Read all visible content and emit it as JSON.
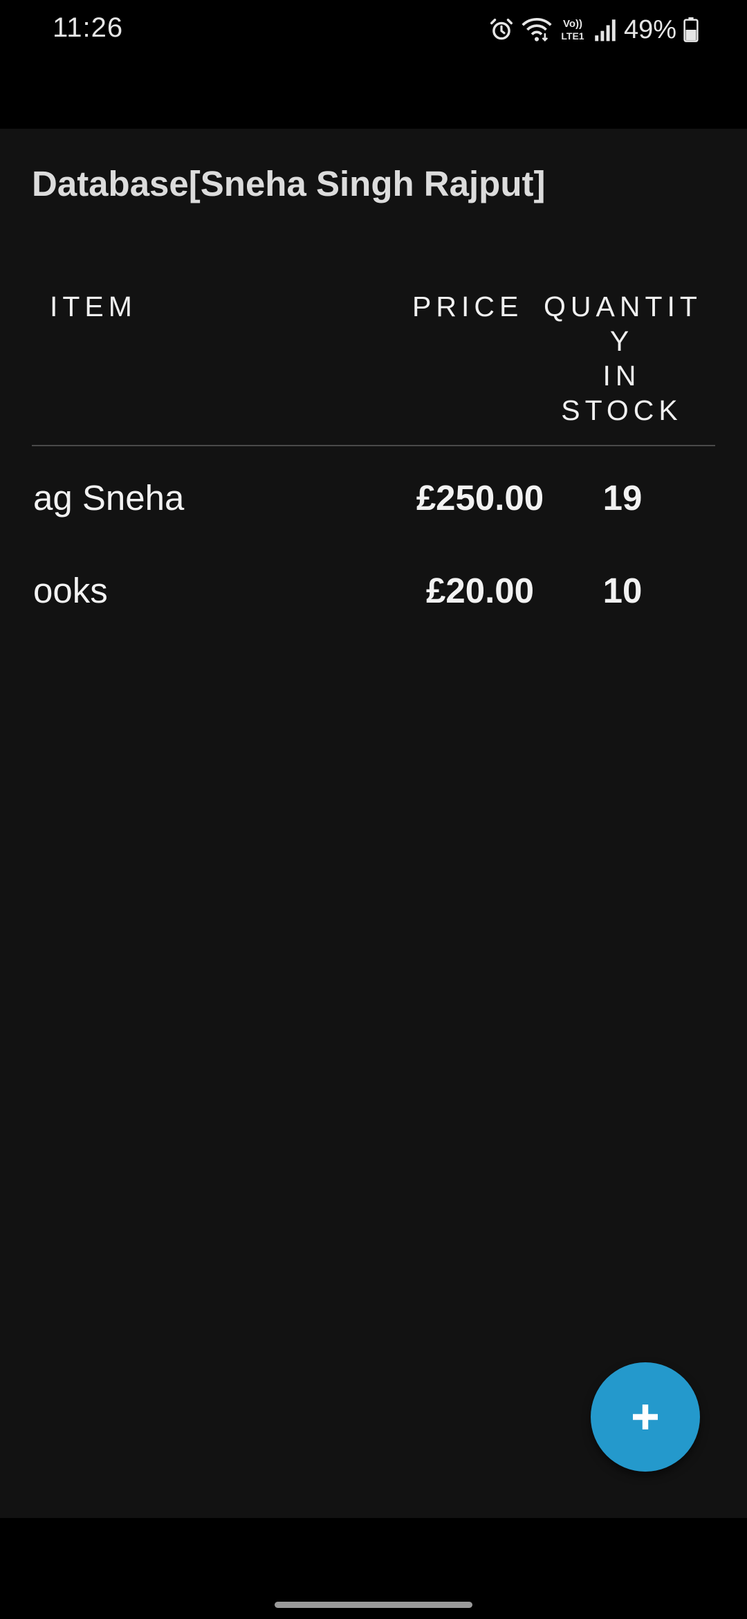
{
  "status_bar": {
    "time": "11:26",
    "battery_percent": "49%",
    "icons": [
      "alarm-icon",
      "wifi-icon",
      "volte-icon",
      "signal-icon",
      "battery-icon"
    ],
    "volte_line1": "Vo))",
    "volte_line2": "LTE1"
  },
  "app": {
    "title": "Database[Sneha Singh Rajput]",
    "columns": {
      "item": "ITEM",
      "price": "PRICE",
      "quantity": "QUANTIT\nY\nIN\nSTOCK"
    },
    "rows": [
      {
        "item": "Bag Sneha",
        "price": "£250.00",
        "quantity": "19"
      },
      {
        "item": "Books",
        "price": "£20.00",
        "quantity": "10"
      }
    ],
    "fab_icon": "plus-icon"
  },
  "colors": {
    "background": "#121212",
    "fab": "#2499cc",
    "divider": "#4a4a4a"
  }
}
